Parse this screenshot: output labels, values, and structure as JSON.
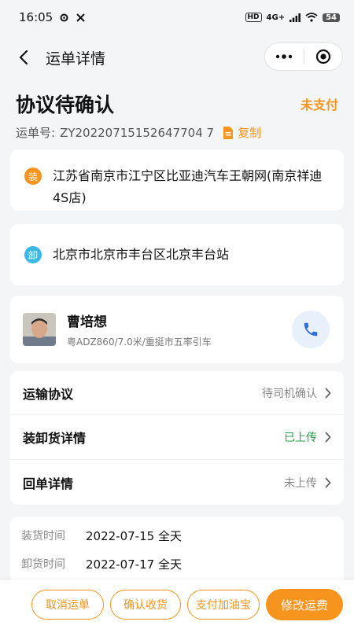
{
  "status_bar": {
    "time": "16:05",
    "battery": "54",
    "network": "4G+",
    "hd": "HD"
  },
  "nav": {
    "title": "运单详情"
  },
  "header": {
    "status": "协议待确认",
    "pay_status": "未支付",
    "order_no_label": "运单号:",
    "order_no": "ZY20220715152647704 7",
    "copy_label": "复制"
  },
  "route": {
    "load": {
      "badge": "装",
      "address": "江苏省南京市江宁区比亚迪汽车王朝网(南京祥迪4S店)"
    },
    "unload": {
      "badge": "卸",
      "address": "北京市北京市丰台区北京丰台站"
    }
  },
  "driver": {
    "name": "曹培想",
    "desc": "粤ADZ860/7.0米/重挺市五率引车"
  },
  "menu": [
    {
      "label": "运输协议",
      "value": "待司机确认"
    },
    {
      "label": "装卸货详情",
      "value": "已上传"
    },
    {
      "label": "回单详情",
      "value": "未上传"
    }
  ],
  "times": [
    {
      "label": "装货时间",
      "value": "2022-07-15 全天"
    },
    {
      "label": "卸货时间",
      "value": "2022-07-17 全天"
    }
  ],
  "actions": {
    "cancel": "取消运单",
    "confirm": "确认收货",
    "pay_fuel": "支付加油宝",
    "modify_fee": "修改运费"
  },
  "colors": {
    "accent": "#f7941d",
    "load_badge": "#f7941d",
    "unload_badge": "#3db7e4",
    "success": "#22a045"
  }
}
